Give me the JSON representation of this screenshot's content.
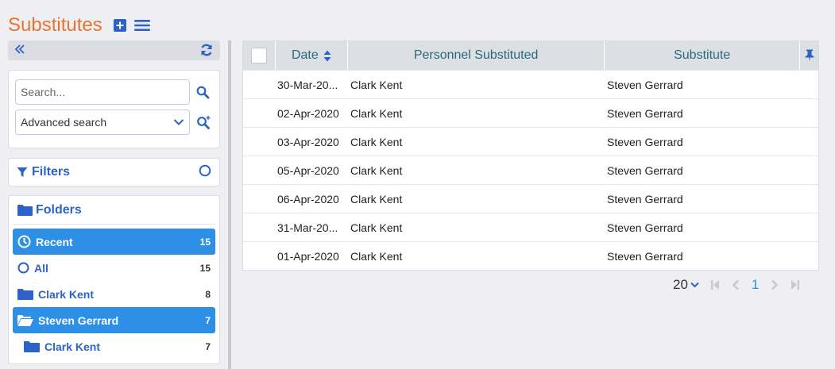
{
  "header": {
    "title": "Substitutes",
    "add_icon": "plus-square-icon",
    "menu_icon": "hamburger-menu-icon"
  },
  "sidebar": {
    "collapse_icon": "double-chevron-left-icon",
    "refresh_icon": "refresh-icon",
    "search": {
      "placeholder": "Search...",
      "value": ""
    },
    "advanced_search": {
      "label": "Advanced search"
    },
    "filters": {
      "label": "Filters"
    },
    "folders": {
      "label": "Folders",
      "items": [
        {
          "label": "Recent",
          "count": "15",
          "icon": "clock-icon",
          "active": true
        },
        {
          "label": "All",
          "count": "15",
          "icon": "circle-icon",
          "active": false
        },
        {
          "label": "Clark Kent",
          "count": "8",
          "icon": "folder-icon",
          "active": false
        },
        {
          "label": "Steven Gerrard",
          "count": "7",
          "icon": "folder-open-icon",
          "active": true
        },
        {
          "label": "Clark Kent",
          "count": "7",
          "icon": "folder-icon",
          "active": false
        }
      ]
    }
  },
  "grid": {
    "columns": {
      "date": "Date",
      "personnel": "Personnel Substituted",
      "substitute": "Substitute"
    },
    "rows": [
      {
        "date": "30-Mar-20...",
        "personnel": "Clark Kent",
        "substitute": "Steven Gerrard"
      },
      {
        "date": "02-Apr-2020",
        "personnel": "Clark Kent",
        "substitute": "Steven Gerrard"
      },
      {
        "date": "03-Apr-2020",
        "personnel": "Clark Kent",
        "substitute": "Steven Gerrard"
      },
      {
        "date": "05-Apr-2020",
        "personnel": "Clark Kent",
        "substitute": "Steven Gerrard"
      },
      {
        "date": "06-Apr-2020",
        "personnel": "Clark Kent",
        "substitute": "Steven Gerrard"
      },
      {
        "date": "31-Mar-20...",
        "personnel": "Clark Kent",
        "substitute": "Steven Gerrard"
      },
      {
        "date": "01-Apr-2020",
        "personnel": "Clark Kent",
        "substitute": "Steven Gerrard"
      }
    ]
  },
  "pager": {
    "page_size": "20",
    "current_page": "1"
  },
  "colors": {
    "accent": "#2d8fe5",
    "title": "#e8742d",
    "link": "#2d63c8",
    "header_text": "#2a6a78"
  }
}
